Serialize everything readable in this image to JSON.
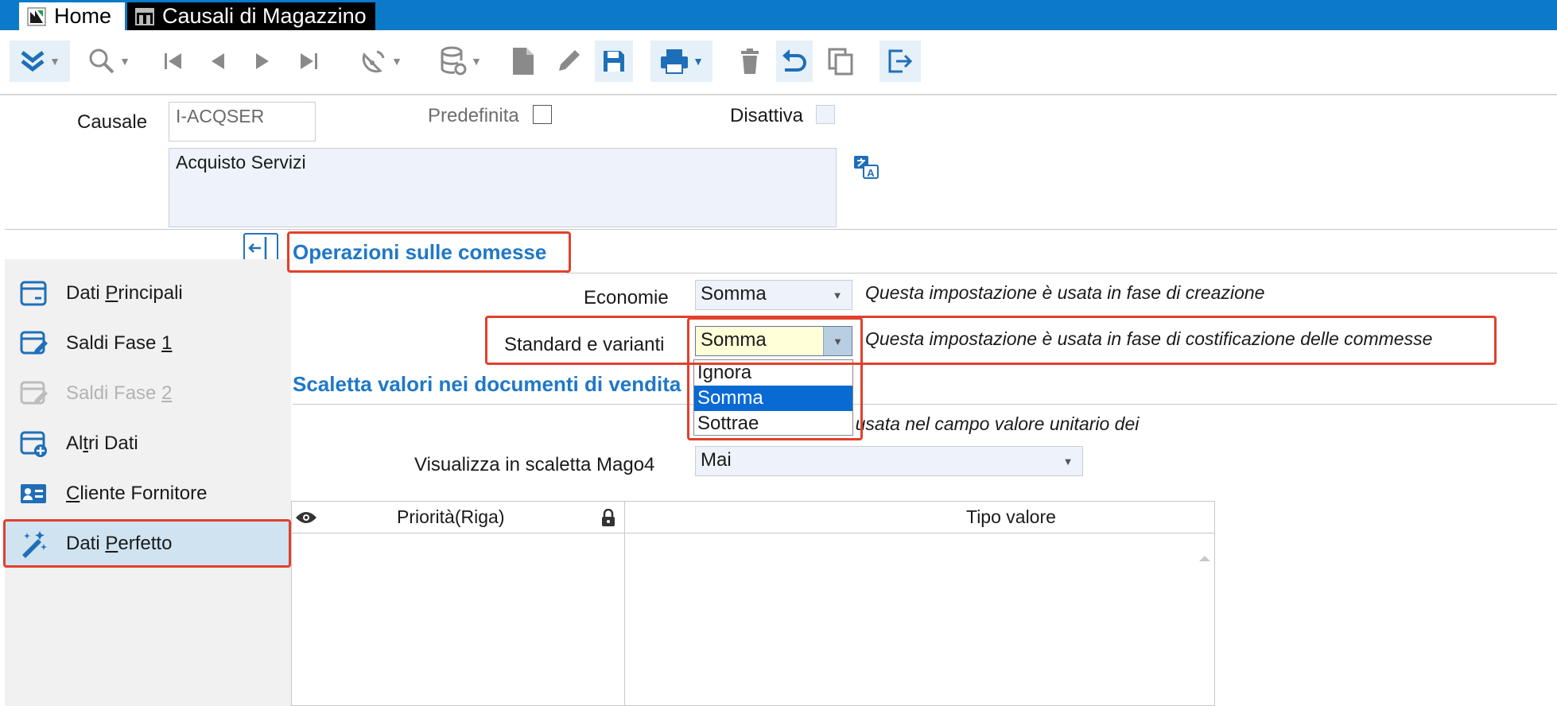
{
  "titlebar": {
    "tabs": [
      {
        "label": "Home"
      },
      {
        "label": "Causali di Magazzino"
      }
    ]
  },
  "toolbar": {
    "icons": [
      "expand-icon",
      "search-icon",
      "first-icon",
      "prev-icon",
      "next-icon",
      "last-icon",
      "radar-icon",
      "database-icon",
      "new-document-icon",
      "edit-icon",
      "save-icon",
      "print-icon",
      "delete-icon",
      "undo-icon",
      "copy-icon",
      "exit-icon"
    ]
  },
  "header": {
    "causale_label": "Causale",
    "causale_value": "I-ACQSER",
    "predefinita_label": "Predefinita",
    "disattiva_label": "Disattiva",
    "description_value": "Acquisto Servizi"
  },
  "sidebar": {
    "items": [
      {
        "pre": "Dati ",
        "key": "P",
        "post": "rincipali",
        "state": "normal"
      },
      {
        "pre": "Saldi Fase ",
        "key": "1",
        "post": "",
        "state": "normal"
      },
      {
        "pre": "Saldi Fase ",
        "key": "2",
        "post": "",
        "state": "disabled"
      },
      {
        "pre": "Al",
        "key": "t",
        "post": "ri Dati",
        "state": "normal"
      },
      {
        "pre": "",
        "key": "C",
        "post": "liente Fornitore",
        "state": "normal"
      },
      {
        "pre": "Dati ",
        "key": "P",
        "post": "erfetto",
        "state": "selected"
      }
    ]
  },
  "main": {
    "section1_title": "Operazioni sulle comesse",
    "economie_label": "Economie",
    "economie_value": "Somma",
    "economie_hint": "Questa impostazione è usata in fase di creazione",
    "standard_label": "Standard e varianti",
    "standard_value": "Somma",
    "standard_hint": "Questa impostazione è usata in fase di costificazione delle commesse",
    "dropdown_options": [
      "Ignora",
      "Somma",
      "Sottrae"
    ],
    "section2_title": "Scaletta valori nei documenti di vendita",
    "section2_hint": "Questa impostazione è usata nel campo valore unitario dei",
    "visualizza_label": "Visualizza in scaletta Mago4",
    "visualizza_value": "Mai",
    "grid": {
      "col1": "Priorità(Riga)",
      "col2": "Tipo valore"
    }
  },
  "colors": {
    "accent": "#1f78c6",
    "highlight": "#e2402c",
    "titlebar": "#0c7ac8",
    "selection": "#0a6ad4"
  }
}
